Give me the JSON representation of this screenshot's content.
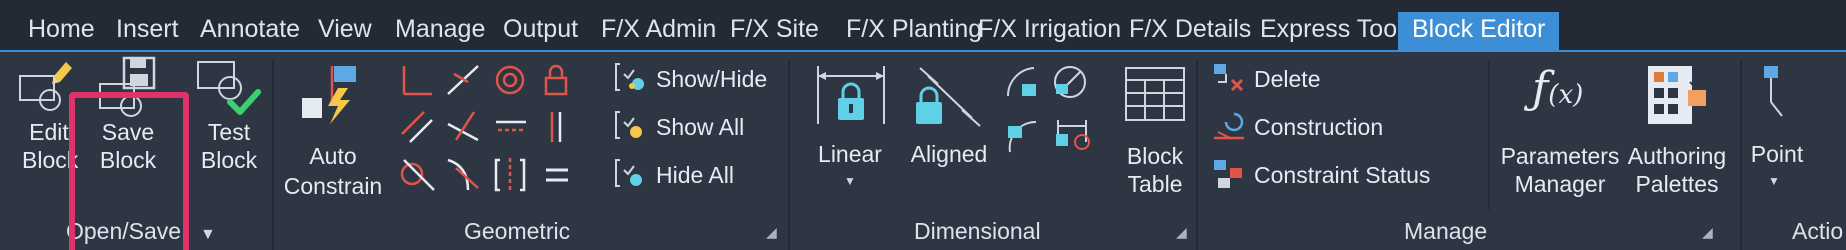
{
  "tabs": {
    "items": [
      {
        "label": "Home"
      },
      {
        "label": "Insert"
      },
      {
        "label": "Annotate"
      },
      {
        "label": "View"
      },
      {
        "label": "Manage"
      },
      {
        "label": "Output"
      },
      {
        "label": "F/X Admin"
      },
      {
        "label": "F/X Site"
      },
      {
        "label": "F/X Planting"
      },
      {
        "label": "F/X Irrigation"
      },
      {
        "label": "F/X Details"
      },
      {
        "label": "Express Tools"
      },
      {
        "label": "Block Editor"
      }
    ],
    "active": "Block Editor"
  },
  "panels": {
    "open_save": {
      "title": "Open/Save",
      "edit_block": {
        "line1": "Edit",
        "line2": "Block"
      },
      "save_block": {
        "line1": "Save",
        "line2": "Block"
      },
      "test_block": {
        "line1": "Test",
        "line2": "Block"
      }
    },
    "geometric": {
      "title": "Geometric",
      "auto_constrain": {
        "line1": "Auto",
        "line2": "Constrain"
      },
      "show_hide": "Show/Hide",
      "show_all": "Show All",
      "hide_all": "Hide All"
    },
    "dimensional": {
      "title": "Dimensional",
      "linear": "Linear",
      "aligned": "Aligned",
      "block_table": {
        "line1": "Block",
        "line2": "Table"
      }
    },
    "manage": {
      "title": "Manage",
      "delete": "Delete",
      "construction": "Construction",
      "constraint_status": "Constraint Status",
      "parameters_manager": {
        "line1": "Parameters",
        "line2": "Manager"
      },
      "authoring_palettes": {
        "line1": "Authoring",
        "line2": "Palettes"
      }
    },
    "action": {
      "title": "Actio",
      "point": "Point"
    }
  },
  "colors": {
    "accent": "#3c8fd6",
    "highlight": "#e0336a",
    "ribbon_bg": "#2e3644",
    "tab_bg": "#232a36",
    "icon_cyan": "#5fd0e6",
    "icon_red": "#e0544a",
    "icon_green": "#3bd16f",
    "icon_yellow": "#f5c84a"
  }
}
